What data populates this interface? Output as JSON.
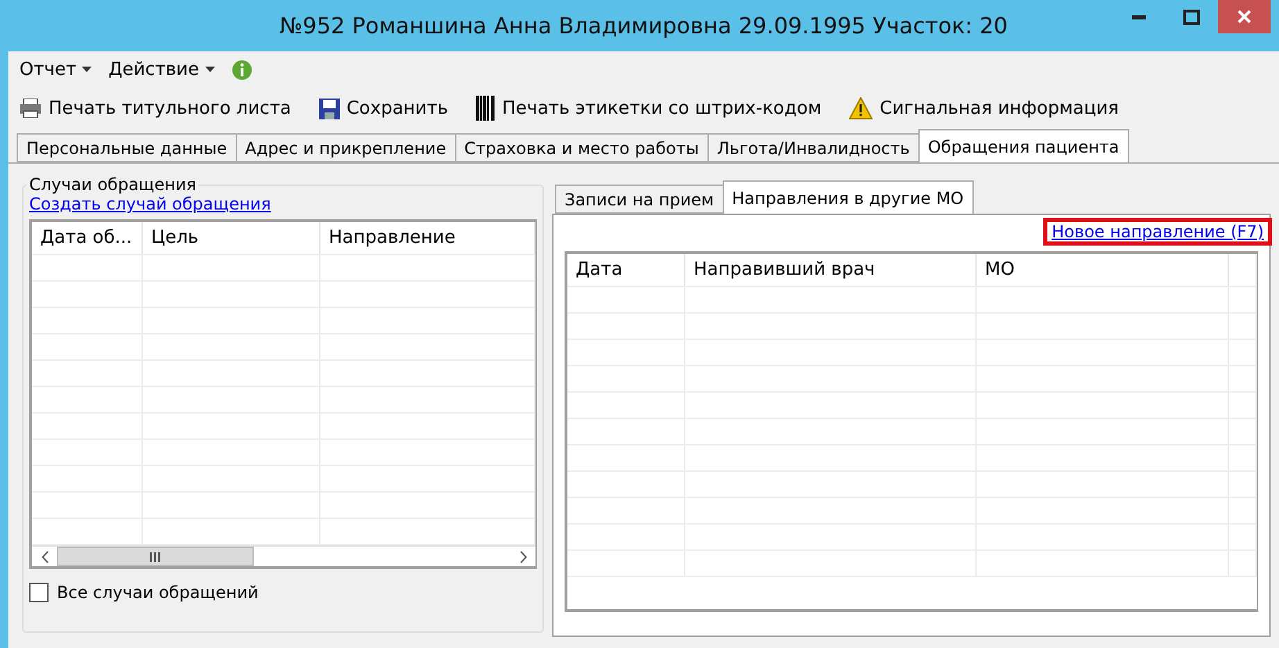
{
  "window": {
    "title": "№952 Романшина Анна Владимировна 29.09.1995 Участок: 20"
  },
  "menu": [
    "Отчет",
    "Действие"
  ],
  "toolbar": [
    {
      "kind": "printer",
      "label": "Печать титульного листа"
    },
    {
      "kind": "save",
      "label": "Сохранить"
    },
    {
      "kind": "barcode",
      "label": "Печать этикетки со штрих-кодом"
    },
    {
      "kind": "warning",
      "label": "Сигнальная информация"
    }
  ],
  "tabs": [
    {
      "label": "Персональные данные",
      "selected": false
    },
    {
      "label": "Адрес и прикрепление",
      "selected": false
    },
    {
      "label": "Страховка и место работы",
      "selected": false
    },
    {
      "label": "Льгота/Инвалидность",
      "selected": false
    },
    {
      "label": "Обращения пациента",
      "selected": true
    }
  ],
  "cases": {
    "title": "Случаи обращения",
    "link": "Создать случай обращения",
    "columns": [
      "Дата об...",
      "Цель",
      "Направление"
    ],
    "checkbox": {
      "label": "Все случаи обращений",
      "checked": false
    }
  },
  "subtabs": [
    {
      "label": "Записи на прием",
      "selected": false
    },
    {
      "label": "Направления в другие МО",
      "selected": true
    }
  ],
  "referrals": {
    "link": "Новое направление (F7)",
    "highlighted": true,
    "columns": [
      "Дата",
      "Направивший врач",
      "МО"
    ]
  }
}
